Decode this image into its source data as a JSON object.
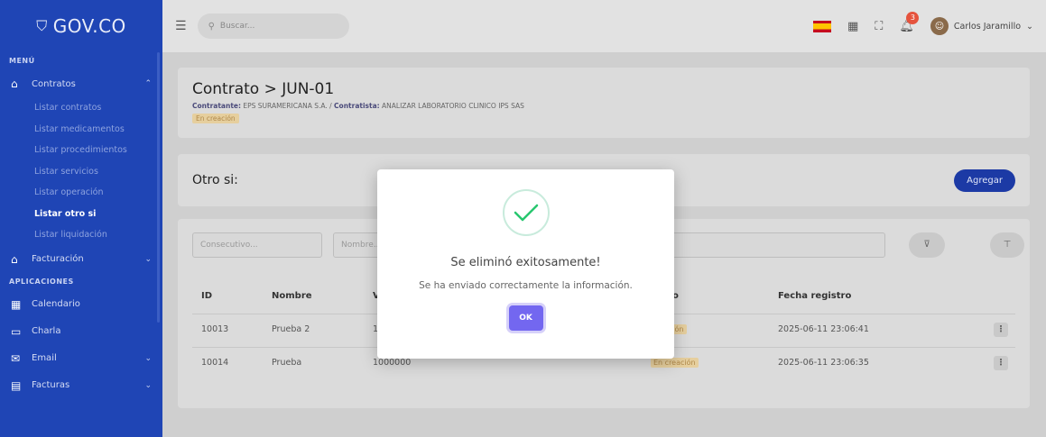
{
  "brand": {
    "name": "GOV.CO"
  },
  "sidebar": {
    "menu_heading": "MENÚ",
    "contratos": {
      "label": "Contratos",
      "icon": "home-icon"
    },
    "sub_items": [
      {
        "label": "Listar contratos"
      },
      {
        "label": "Listar medicamentos"
      },
      {
        "label": "Listar procedimientos"
      },
      {
        "label": "Listar servicios"
      },
      {
        "label": "Listar operación"
      },
      {
        "label": "Listar otro si",
        "active": true
      },
      {
        "label": "Listar liquidación"
      }
    ],
    "facturacion": {
      "label": "Facturación"
    },
    "apps_heading": "APLICACIONES",
    "apps": [
      {
        "label": "Calendario",
        "icon": "calendar-icon"
      },
      {
        "label": "Charla",
        "icon": "chat-icon"
      },
      {
        "label": "Email",
        "icon": "mail-icon"
      },
      {
        "label": "Facturas",
        "icon": "invoice-icon"
      }
    ]
  },
  "topbar": {
    "search_placeholder": "Buscar...",
    "notification_count": "3",
    "user_name": "Carlos Jaramillo"
  },
  "contract": {
    "title": "Contrato > JUN-01",
    "contratante_label": "Contratante:",
    "contratante_value": "EPS SURAMERICANA S.A.",
    "separator": " / ",
    "contratista_label": "Contratista:",
    "contratista_value": "ANALIZAR LABORATORIO CLINICO IPS SAS",
    "status": "En creación"
  },
  "otro_si": {
    "title": "Otro si:",
    "add_button": "Agregar"
  },
  "filters": {
    "consecutivo_placeholder": "Consecutivo...",
    "nombre_placeholder": "Nombre..."
  },
  "table": {
    "headers": {
      "id": "ID",
      "nombre": "Nombre",
      "valor": "V",
      "estado": "o",
      "fecha": "Fecha registro"
    },
    "rows": [
      {
        "id": "10013",
        "nombre": "Prueba 2",
        "valor": "1(",
        "estado": "ación",
        "fecha": "2025-06-11 23:06:41"
      },
      {
        "id": "10014",
        "nombre": "Prueba",
        "valor": "1000000",
        "estado": "En creación",
        "fecha": "2025-06-11 23:06:35"
      }
    ]
  },
  "modal": {
    "title": "Se eliminó exitosamente!",
    "text": "Se ha enviado correctamente la información.",
    "ok_button": "OK"
  },
  "colors": {
    "sidebar_bg": "#1f45b5",
    "primary_button": "#1c3aa5",
    "ok_button": "#7367f0",
    "success_check": "#28c76f",
    "status_badge": "#e6cf9e"
  }
}
